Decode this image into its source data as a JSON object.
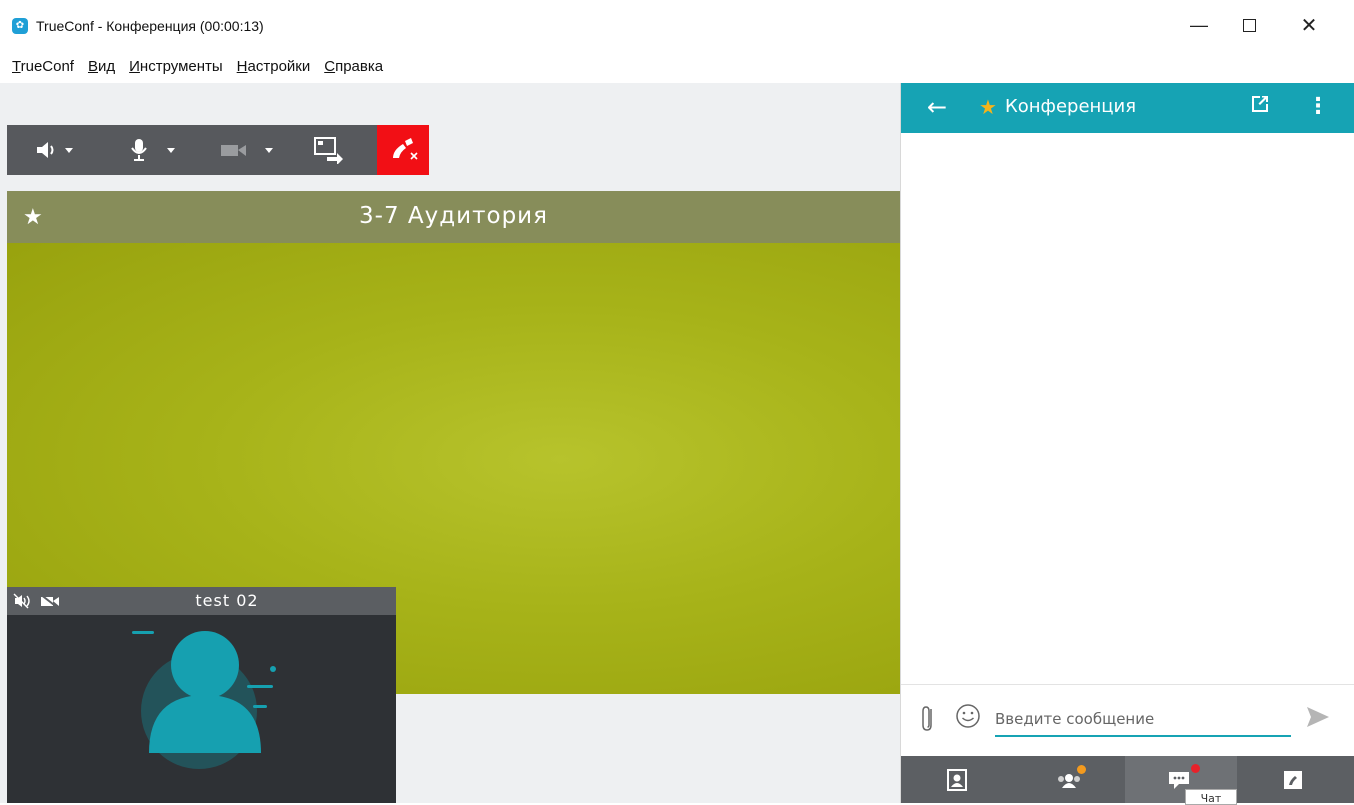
{
  "window": {
    "title": "TrueConf - Конференция (00:00:13)",
    "minimize_glyph": "—",
    "close_glyph": "✕"
  },
  "menu": [
    {
      "underline": "T",
      "rest": "rueConf"
    },
    {
      "underline": "В",
      "rest": "ид"
    },
    {
      "underline": "И",
      "rest": "нструменты"
    },
    {
      "underline": "Н",
      "rest": "астройки"
    },
    {
      "underline": "С",
      "rest": "правка"
    }
  ],
  "toolbar": {
    "icons": [
      "speaker-icon",
      "microphone-icon",
      "camera-icon",
      "share-screen-icon",
      "hangup-icon"
    ],
    "accent_end": "#f20f15"
  },
  "conference": {
    "title": "3-7 Аудитория"
  },
  "pip": {
    "name": "test 02",
    "icons": [
      "speaker-muted-icon",
      "camera-off-icon",
      "avatar-icon"
    ]
  },
  "side": {
    "header_title": "Конференция",
    "back_glyph": "←",
    "star_glyph": "★",
    "more_glyph": "⋮",
    "accent": "#16a3b4",
    "star_color": "#f5b41a"
  },
  "composer": {
    "placeholder": "Введите сообщение",
    "icons": [
      "attachment-icon",
      "emoji-icon",
      "send-icon"
    ]
  },
  "bottom_nav": {
    "items": [
      "contacts-icon",
      "participants-icon",
      "chat-icon",
      "call-icon"
    ],
    "tooltip": "Чат",
    "badge_orange": "#f39a1e",
    "badge_red": "#e8222a"
  }
}
